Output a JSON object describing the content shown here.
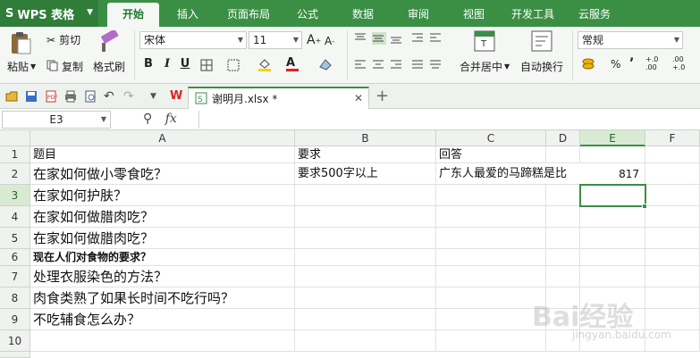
{
  "app": {
    "name": "WPS 表格",
    "logo": "S"
  },
  "tabs": [
    "开始",
    "插入",
    "页面布局",
    "公式",
    "数据",
    "审阅",
    "视图",
    "开发工具",
    "云服务"
  ],
  "active_tab": 0,
  "ribbon": {
    "paste": "粘贴",
    "cut": "剪切",
    "copy": "复制",
    "format_painter": "格式刷",
    "font_name": "宋体",
    "font_size": "11",
    "bold": "B",
    "italic": "I",
    "underline": "U",
    "merge_center": "合并居中",
    "wrap_text": "自动换行",
    "number_format": "常规",
    "percent": "%",
    "comma": "’",
    "inc_decimal": "+.0 .00",
    "dec_decimal": ".00 +.0"
  },
  "doc_tab": {
    "title": "谢明月.xlsx *"
  },
  "formula_bar": {
    "cell_ref": "E3",
    "fx": "fx",
    "content": ""
  },
  "columns": [
    "A",
    "B",
    "C",
    "D",
    "E",
    "F"
  ],
  "selected_column": "E",
  "rows": [
    "1",
    "2",
    "3",
    "4",
    "5",
    "6",
    "7",
    "8",
    "9",
    "10"
  ],
  "selected_row": "3",
  "cells": {
    "r1": {
      "a": "题目",
      "b": "要求",
      "c": "回答"
    },
    "r2": {
      "a": "在家如何做小零食吃？",
      "b": "要求500字以上",
      "c": "广东人最爱的马蹄糕是比",
      "e": "817"
    },
    "r3": {
      "a": "在家如何护肤？"
    },
    "r4": {
      "a": "在家如何做腊肉吃？"
    },
    "r5": {
      "a": "在家如何做腊肉吃？"
    },
    "r6": {
      "a": "现在人们对食物的要求？"
    },
    "r7": {
      "a": "处理衣服染色的方法？"
    },
    "r8": {
      "a": "肉食类熟了如果长时间不吃行吗？"
    },
    "r9": {
      "a": "不吃辅食怎么办？"
    }
  },
  "watermark": {
    "text": "Bai经验",
    "sub": "jingyan.baidu.com"
  },
  "colors": {
    "accent": "#3a8f45",
    "selection": "#3a8f45"
  }
}
